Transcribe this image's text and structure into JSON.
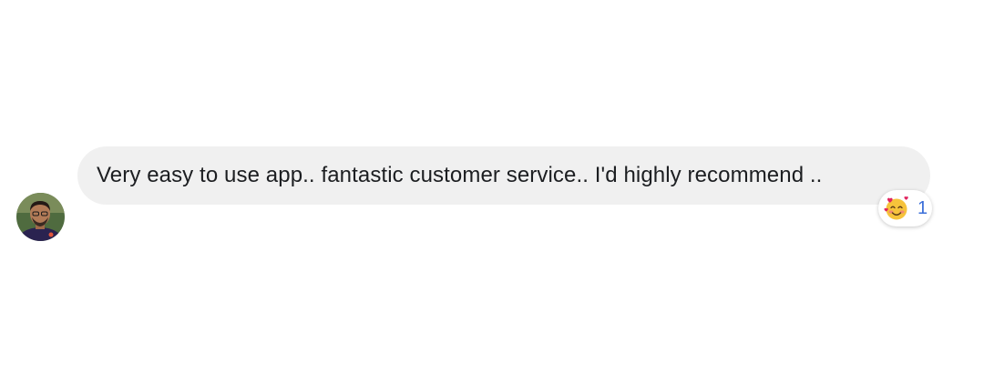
{
  "comment": {
    "text": "Very easy to use app.. fantastic customer service.. I'd highly recommend .."
  },
  "reactions": {
    "icon": "smiling-face-with-hearts-icon",
    "count": "1"
  },
  "colors": {
    "bubble_background": "#f0f0f0",
    "text": "#1c1e21",
    "reaction_count": "#3b6fd9"
  }
}
